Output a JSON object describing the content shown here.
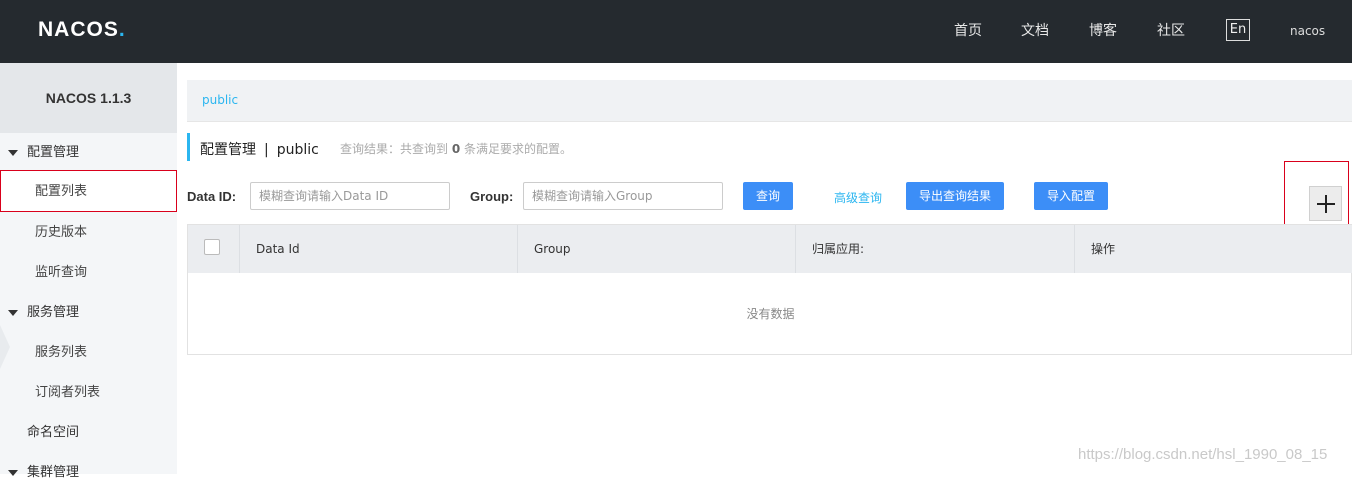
{
  "header": {
    "logo": "NACOS",
    "logo_dot": ".",
    "nav": [
      "首页",
      "文档",
      "博客",
      "社区"
    ],
    "lang": "En",
    "user": "nacos"
  },
  "sidebar": {
    "version": "NACOS 1.1.3",
    "groups": [
      {
        "label": "配置管理",
        "items": [
          "配置列表",
          "历史版本",
          "监听查询"
        ]
      },
      {
        "label": "服务管理",
        "items": [
          "服务列表",
          "订阅者列表"
        ]
      }
    ],
    "namespace": "命名空间",
    "cluster": "集群管理",
    "active_item": "配置列表"
  },
  "breadcrumb": {
    "namespace": "public"
  },
  "page": {
    "title": "配置管理",
    "separator": "|",
    "namespace": "public",
    "summary_prefix": "查询结果：共查询到",
    "summary_count": "0",
    "summary_suffix": "条满足要求的配置。"
  },
  "filters": {
    "dataid_label": "Data ID:",
    "dataid_placeholder": "模糊查询请输入Data ID",
    "group_label": "Group:",
    "group_placeholder": "模糊查询请输入Group",
    "query_button": "查询",
    "advanced_link": "高级查询",
    "export_button": "导出查询结果",
    "import_button": "导入配置"
  },
  "table": {
    "columns": [
      "Data Id",
      "Group",
      "归属应用:",
      "操作"
    ],
    "empty_text": "没有数据"
  },
  "watermark": "https://blog.csdn.net/hsl_1990_08_15",
  "colors": {
    "topbar": "#252a2f",
    "accent": "#2bb6f0",
    "primary_button": "#3c8ef7",
    "highlight": "#d9001b"
  }
}
